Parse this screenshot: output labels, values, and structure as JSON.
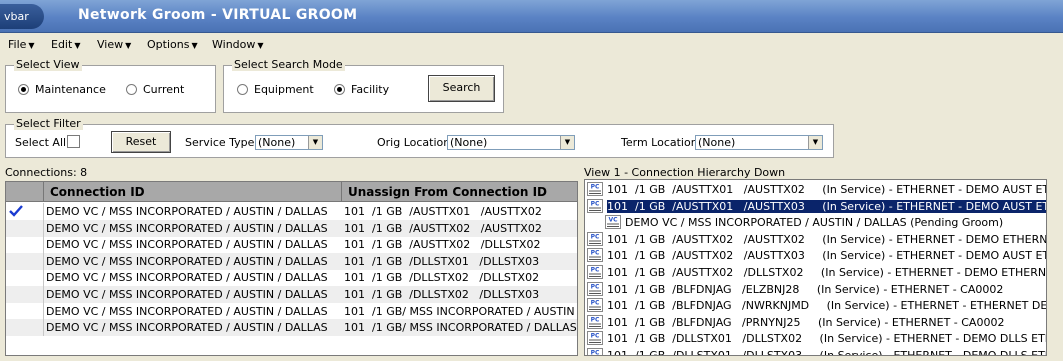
{
  "window": {
    "app_label": "vbar",
    "title": "Network Groom - VIRTUAL GROOM"
  },
  "menu": [
    {
      "label": "File"
    },
    {
      "label": "Edit"
    },
    {
      "label": "View"
    },
    {
      "label": "Options"
    },
    {
      "label": "Window"
    }
  ],
  "select_view": {
    "title": "Select View",
    "options": [
      {
        "label": "Maintenance",
        "selected": true
      },
      {
        "label": "Current",
        "selected": false
      }
    ]
  },
  "search_mode": {
    "title": "Select Search Mode",
    "options": [
      {
        "label": "Equipment",
        "selected": false
      },
      {
        "label": "Facility",
        "selected": true
      }
    ],
    "search_button": "Search"
  },
  "filter": {
    "title": "Select Filter",
    "select_all_label": "Select All",
    "reset_button": "Reset",
    "service_type_label": "Service Type:",
    "service_type_value": "(None)",
    "orig_location_label": "Orig Location:",
    "orig_location_value": "(None)",
    "term_location_label": "Term Location:",
    "term_location_value": "(None)"
  },
  "connections": {
    "count_label": "Connections: 8",
    "headers": [
      "Connection ID",
      "Unassign From Connection ID"
    ],
    "rows": [
      {
        "checked": true,
        "id": "DEMO VC / MSS INCORPORATED / AUSTIN / DALLAS",
        "unassign": "101  /1 GB  /AUSTTX01   /AUSTTX02"
      },
      {
        "checked": false,
        "id": "DEMO VC / MSS INCORPORATED / AUSTIN / DALLAS",
        "unassign": "101  /1 GB  /AUSTTX02   /AUSTTX02"
      },
      {
        "checked": false,
        "id": "DEMO VC / MSS INCORPORATED / AUSTIN / DALLAS",
        "unassign": "101  /1 GB  /AUSTTX02   /DLLSTX02"
      },
      {
        "checked": false,
        "id": "DEMO VC / MSS INCORPORATED / AUSTIN / DALLAS",
        "unassign": "101  /1 GB  /DLLSTX01   /DLLSTX03"
      },
      {
        "checked": false,
        "id": "DEMO VC / MSS INCORPORATED / AUSTIN / DALLAS",
        "unassign": "101  /1 GB  /DLLSTX02   /DLLSTX02"
      },
      {
        "checked": false,
        "id": "DEMO VC / MSS INCORPORATED / AUSTIN / DALLAS",
        "unassign": "101  /1 GB  /DLLSTX02   /DLLSTX03"
      },
      {
        "checked": false,
        "id": "DEMO VC / MSS INCORPORATED / AUSTIN / DALLAS",
        "unassign": "101  /1 GB/ MSS INCORPORATED / AUSTIN"
      },
      {
        "checked": false,
        "id": "DEMO VC / MSS INCORPORATED / AUSTIN / DALLAS",
        "unassign": "101  /1 GB/ MSS INCORPORATED / DALLAS"
      }
    ]
  },
  "hierarchy": {
    "title": "View 1 - Connection Hierarchy Down",
    "items": [
      {
        "icon": "PC",
        "text": "101  /1 GB  /AUSTTX01   /AUSTTX02     (In Service) - ETHERNET - DEMO AUST ETH ACCESS",
        "selected": false,
        "indent": 0
      },
      {
        "icon": "PC",
        "text": "101  /1 GB  /AUSTTX01   /AUSTTX03     (In Service) - ETHERNET - DEMO AUST ETH ACCESS",
        "selected": true,
        "indent": 0
      },
      {
        "icon": "VC",
        "text": "DEMO VC / MSS INCORPORATED / AUSTIN / DALLAS (Pending Groom)",
        "selected": false,
        "indent": 1
      },
      {
        "icon": "PC",
        "text": "101  /1 GB  /AUSTTX02   /AUSTTX02     (In Service) - ETHERNET - DEMO ETHERNET",
        "selected": false,
        "indent": 0
      },
      {
        "icon": "PC",
        "text": "101  /1 GB  /AUSTTX02   /AUSTTX03     (In Service) - ETHERNET - DEMO AUST ETH ACCESS",
        "selected": false,
        "indent": 0
      },
      {
        "icon": "PC",
        "text": "101  /1 GB  /AUSTTX02   /DLLSTX02     (In Service) - ETHERNET - DEMO ETHERNET CORE",
        "selected": false,
        "indent": 0
      },
      {
        "icon": "PC",
        "text": "101  /1 GB  /BLFDNJAG   /ELZBNJ28     (In Service) - ETHERNET - CA0002",
        "selected": false,
        "indent": 0
      },
      {
        "icon": "PC",
        "text": "101  /1 GB  /BLFDNJAG   /NWRKNJMD     (In Service) - ETHERNET - ETHERNET DEMO",
        "selected": false,
        "indent": 0
      },
      {
        "icon": "PC",
        "text": "101  /1 GB  /BLFDNJAG   /PRNYNJ25     (In Service) - ETHERNET - CA0002",
        "selected": false,
        "indent": 0
      },
      {
        "icon": "PC",
        "text": "101  /1 GB  /DLLSTX01   /DLLSTX02     (In Service) - ETHERNET - DEMO DLLS ETH ACCESS",
        "selected": false,
        "indent": 0
      },
      {
        "icon": "PC",
        "text": "101  /1 GB  /DLLSTX01   /DLLSTX03     (In Service) - ETHERNET - DEMO DLLS ETH ACCESS",
        "selected": false,
        "indent": 0
      }
    ]
  },
  "colors": {
    "title_bar": "#5a82c4",
    "selection": "#0a246a",
    "header": "#a8a8a8"
  }
}
